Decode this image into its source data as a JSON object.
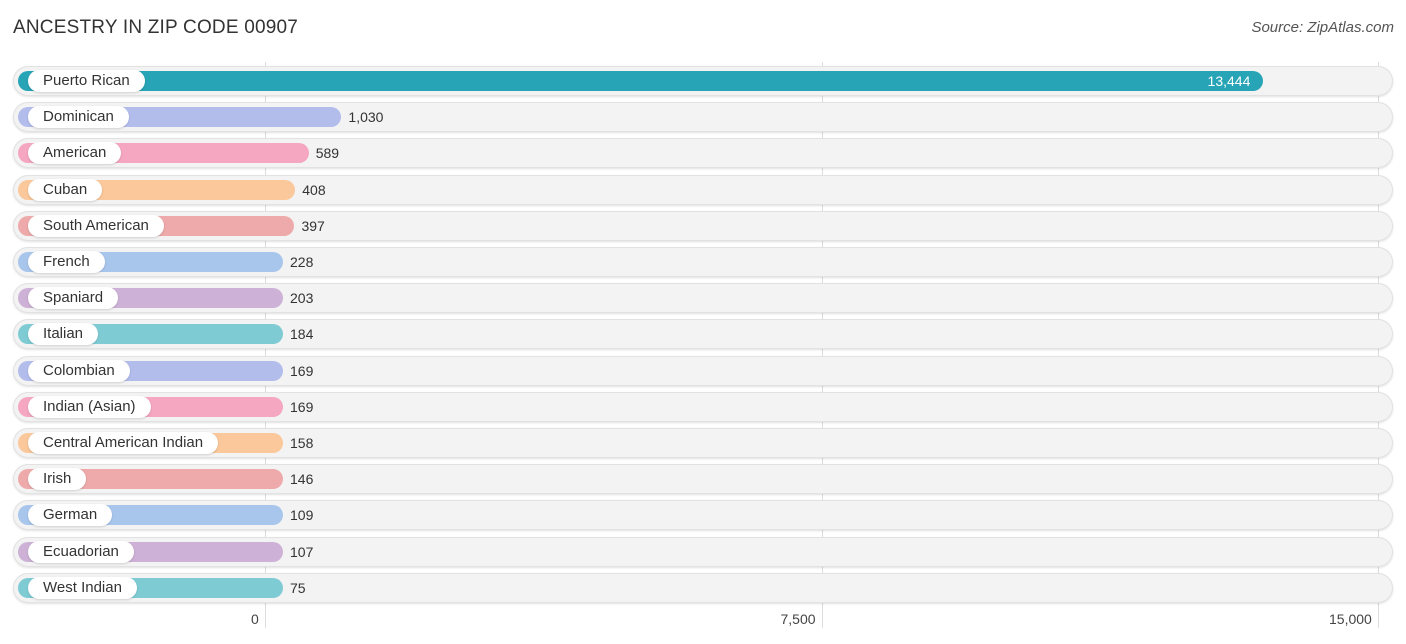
{
  "header": {
    "title": "ANCESTRY IN ZIP CODE 00907",
    "source": "Source: ZipAtlas.com"
  },
  "chart_data": {
    "type": "bar",
    "orientation": "horizontal",
    "title": "ANCESTRY IN ZIP CODE 00907",
    "xlabel": "",
    "ylabel": "",
    "xlim": [
      0,
      15000
    ],
    "grid": true,
    "x_ticks": [
      {
        "value": 0,
        "label": "0"
      },
      {
        "value": 7500,
        "label": "7,500"
      },
      {
        "value": 15000,
        "label": "15,000"
      }
    ],
    "categories": [
      "Puerto Rican",
      "Dominican",
      "American",
      "Cuban",
      "South American",
      "French",
      "Spaniard",
      "Italian",
      "Colombian",
      "Indian (Asian)",
      "Central American Indian",
      "Irish",
      "German",
      "Ecuadorian",
      "West Indian"
    ],
    "values": [
      13444,
      1030,
      589,
      408,
      397,
      228,
      203,
      184,
      169,
      169,
      158,
      146,
      109,
      107,
      75
    ],
    "value_labels": [
      "13,444",
      "1,030",
      "589",
      "408",
      "397",
      "228",
      "203",
      "184",
      "169",
      "169",
      "158",
      "146",
      "109",
      "107",
      "75"
    ],
    "colors": [
      "#27a4b6",
      "#b3bdec",
      "#f5a6c1",
      "#fac89a",
      "#eeaaaa",
      "#a8c6ec",
      "#cdb1d6",
      "#7ecbd4",
      "#b3bdec",
      "#f5a6c1",
      "#fac89a",
      "#eeaaaa",
      "#a8c6ec",
      "#cdb1d6",
      "#7ecbd4"
    ]
  }
}
